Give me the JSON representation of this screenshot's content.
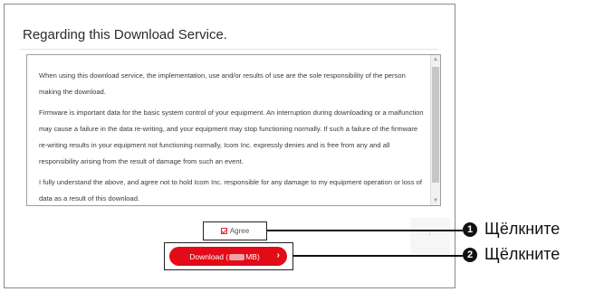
{
  "dialog": {
    "title": "Regarding this Download Service.",
    "paragraphs": [
      "When using this download service, the implementation, use and/or results of use are the sole responsibility of the person making the download.",
      "Firmware is important data for the basic system control of your equipment. An interruption during downloading or a malfunction may cause a failure in the data re-writing, and your equipment may stop functioning normally. If such a failure of the firmware re-writing results in your equipment not functioning normally, Icom Inc. expressly denies and is free from any and all responsibility arising from the result of damage from such an event.",
      "I fully understand the above, and agree not to hold Icom Inc. responsible for any damage to my equipment operation or loss of data as a result of this download."
    ],
    "agree_label": "Agree",
    "agree_checked": true,
    "download_prefix": "Download (",
    "download_suffix": "MB)",
    "download_color": "#e20b17"
  },
  "callouts": [
    {
      "number": "1",
      "text": "Щёлкните"
    },
    {
      "number": "2",
      "text": "Щёлкните"
    }
  ],
  "icons": {
    "checkbox": "checkbox-checked-icon",
    "chevron": "chevron-right-icon"
  }
}
